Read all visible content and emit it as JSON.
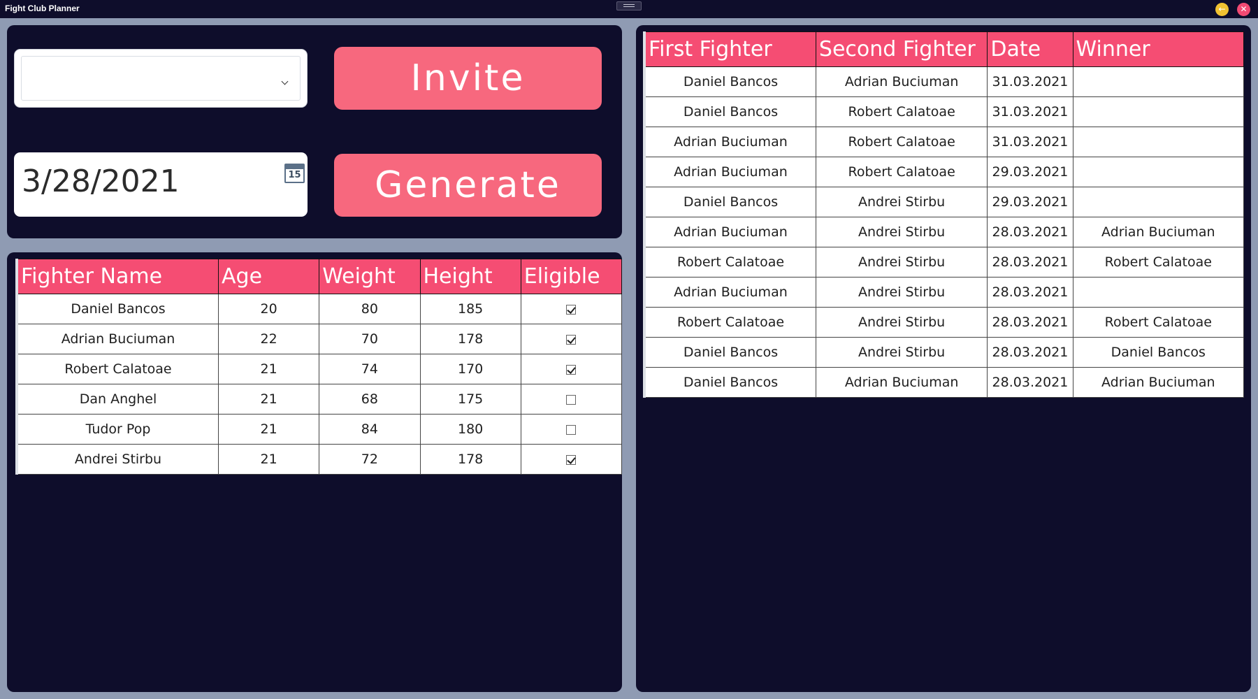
{
  "window": {
    "title": "Fight Club Planner"
  },
  "controls": {
    "fighter_select_value": "",
    "date_value": "3/28/2021",
    "calendar_day": "15",
    "invite_label": "Invite",
    "generate_label": "Generate"
  },
  "fighters": {
    "headers": [
      "Fighter Name",
      "Age",
      "Weight",
      "Height",
      "Eligible"
    ],
    "rows": [
      {
        "name": "Daniel Bancos",
        "age": "20",
        "weight": "80",
        "height": "185",
        "eligible": true
      },
      {
        "name": "Adrian Buciuman",
        "age": "22",
        "weight": "70",
        "height": "178",
        "eligible": true
      },
      {
        "name": "Robert Calatoae",
        "age": "21",
        "weight": "74",
        "height": "170",
        "eligible": true
      },
      {
        "name": "Dan Anghel",
        "age": "21",
        "weight": "68",
        "height": "175",
        "eligible": false
      },
      {
        "name": "Tudor Pop",
        "age": "21",
        "weight": "84",
        "height": "180",
        "eligible": false
      },
      {
        "name": "Andrei Stirbu",
        "age": "21",
        "weight": "72",
        "height": "178",
        "eligible": true
      }
    ]
  },
  "fights": {
    "headers": [
      "First Fighter",
      "Second Fighter",
      "Date",
      "Winner"
    ],
    "rows": [
      {
        "first": "Daniel Bancos",
        "second": "Adrian Buciuman",
        "date": "31.03.2021",
        "winner": ""
      },
      {
        "first": "Daniel Bancos",
        "second": "Robert Calatoae",
        "date": "31.03.2021",
        "winner": ""
      },
      {
        "first": "Adrian Buciuman",
        "second": "Robert Calatoae",
        "date": "31.03.2021",
        "winner": ""
      },
      {
        "first": "Adrian Buciuman",
        "second": "Robert Calatoae",
        "date": "29.03.2021",
        "winner": ""
      },
      {
        "first": "Daniel Bancos",
        "second": "Andrei Stirbu",
        "date": "29.03.2021",
        "winner": ""
      },
      {
        "first": "Adrian Buciuman",
        "second": "Andrei Stirbu",
        "date": "28.03.2021",
        "winner": "Adrian Buciuman"
      },
      {
        "first": "Robert Calatoae",
        "second": "Andrei Stirbu",
        "date": "28.03.2021",
        "winner": "Robert Calatoae"
      },
      {
        "first": "Adrian Buciuman",
        "second": "Andrei Stirbu",
        "date": "28.03.2021",
        "winner": ""
      },
      {
        "first": "Robert Calatoae",
        "second": "Andrei Stirbu",
        "date": "28.03.2021",
        "winner": "Robert Calatoae"
      },
      {
        "first": "Daniel Bancos",
        "second": "Andrei Stirbu",
        "date": "28.03.2021",
        "winner": "Daniel Bancos"
      },
      {
        "first": "Daniel Bancos",
        "second": "Adrian Buciuman",
        "date": "28.03.2021",
        "winner": "Adrian Buciuman"
      }
    ]
  }
}
